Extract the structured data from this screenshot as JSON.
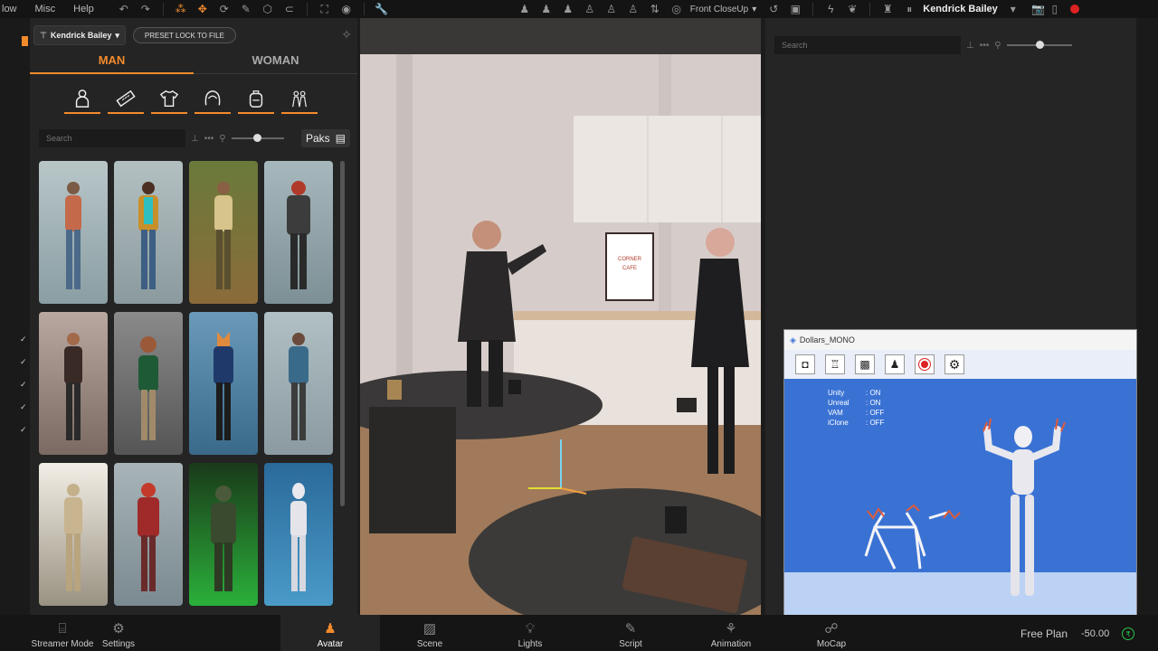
{
  "menu": {
    "items": [
      "low",
      "Misc",
      "Help"
    ]
  },
  "toolbar": {
    "camera_label": "Front CloseUp",
    "user_name": "Kendrick Bailey"
  },
  "avatar_panel": {
    "user_dropdown": "Kendrick Bailey",
    "preset_button": "PRESET LOCK TO FILE",
    "tabs": [
      {
        "label": "MAN",
        "active": true
      },
      {
        "label": "WOMAN",
        "active": false
      }
    ],
    "categories": [
      "body-icon",
      "measure-icon",
      "shirt-icon",
      "hair-icon",
      "backpack-icon",
      "group-icon"
    ],
    "search_placeholder": "Search",
    "paks_label": "Paks",
    "check_marks": [
      "✓",
      "✓",
      "✓",
      "✓",
      "✓"
    ]
  },
  "outliner": {
    "search_placeholder": "Search"
  },
  "dollars_mono": {
    "title": "Dollars_MONO",
    "status": [
      {
        "name": "Unity",
        "value": ": ON"
      },
      {
        "name": "Unreal",
        "value": ": ON"
      },
      {
        "name": "VAM",
        "value": ": OFF"
      },
      {
        "name": "iClone",
        "value": ": OFF"
      }
    ]
  },
  "viewport": {
    "sign_line1": "CORNER",
    "sign_line2": "CAFE"
  },
  "bottom_bar": {
    "left": [
      {
        "label": "Streamer Mode"
      },
      {
        "label": "Settings"
      }
    ],
    "tabs": [
      {
        "label": "Avatar",
        "active": true
      },
      {
        "label": "Scene",
        "active": false
      },
      {
        "label": "Lights",
        "active": false
      },
      {
        "label": "Script",
        "active": false
      },
      {
        "label": "Animation",
        "active": false
      },
      {
        "label": "MoCap",
        "active": false
      }
    ],
    "plan": "Free Plan",
    "credits": "-50.00"
  },
  "colors": {
    "accent": "#f28b2c",
    "mono_bg": "#3a72d4",
    "credit": "#2ec44e"
  }
}
